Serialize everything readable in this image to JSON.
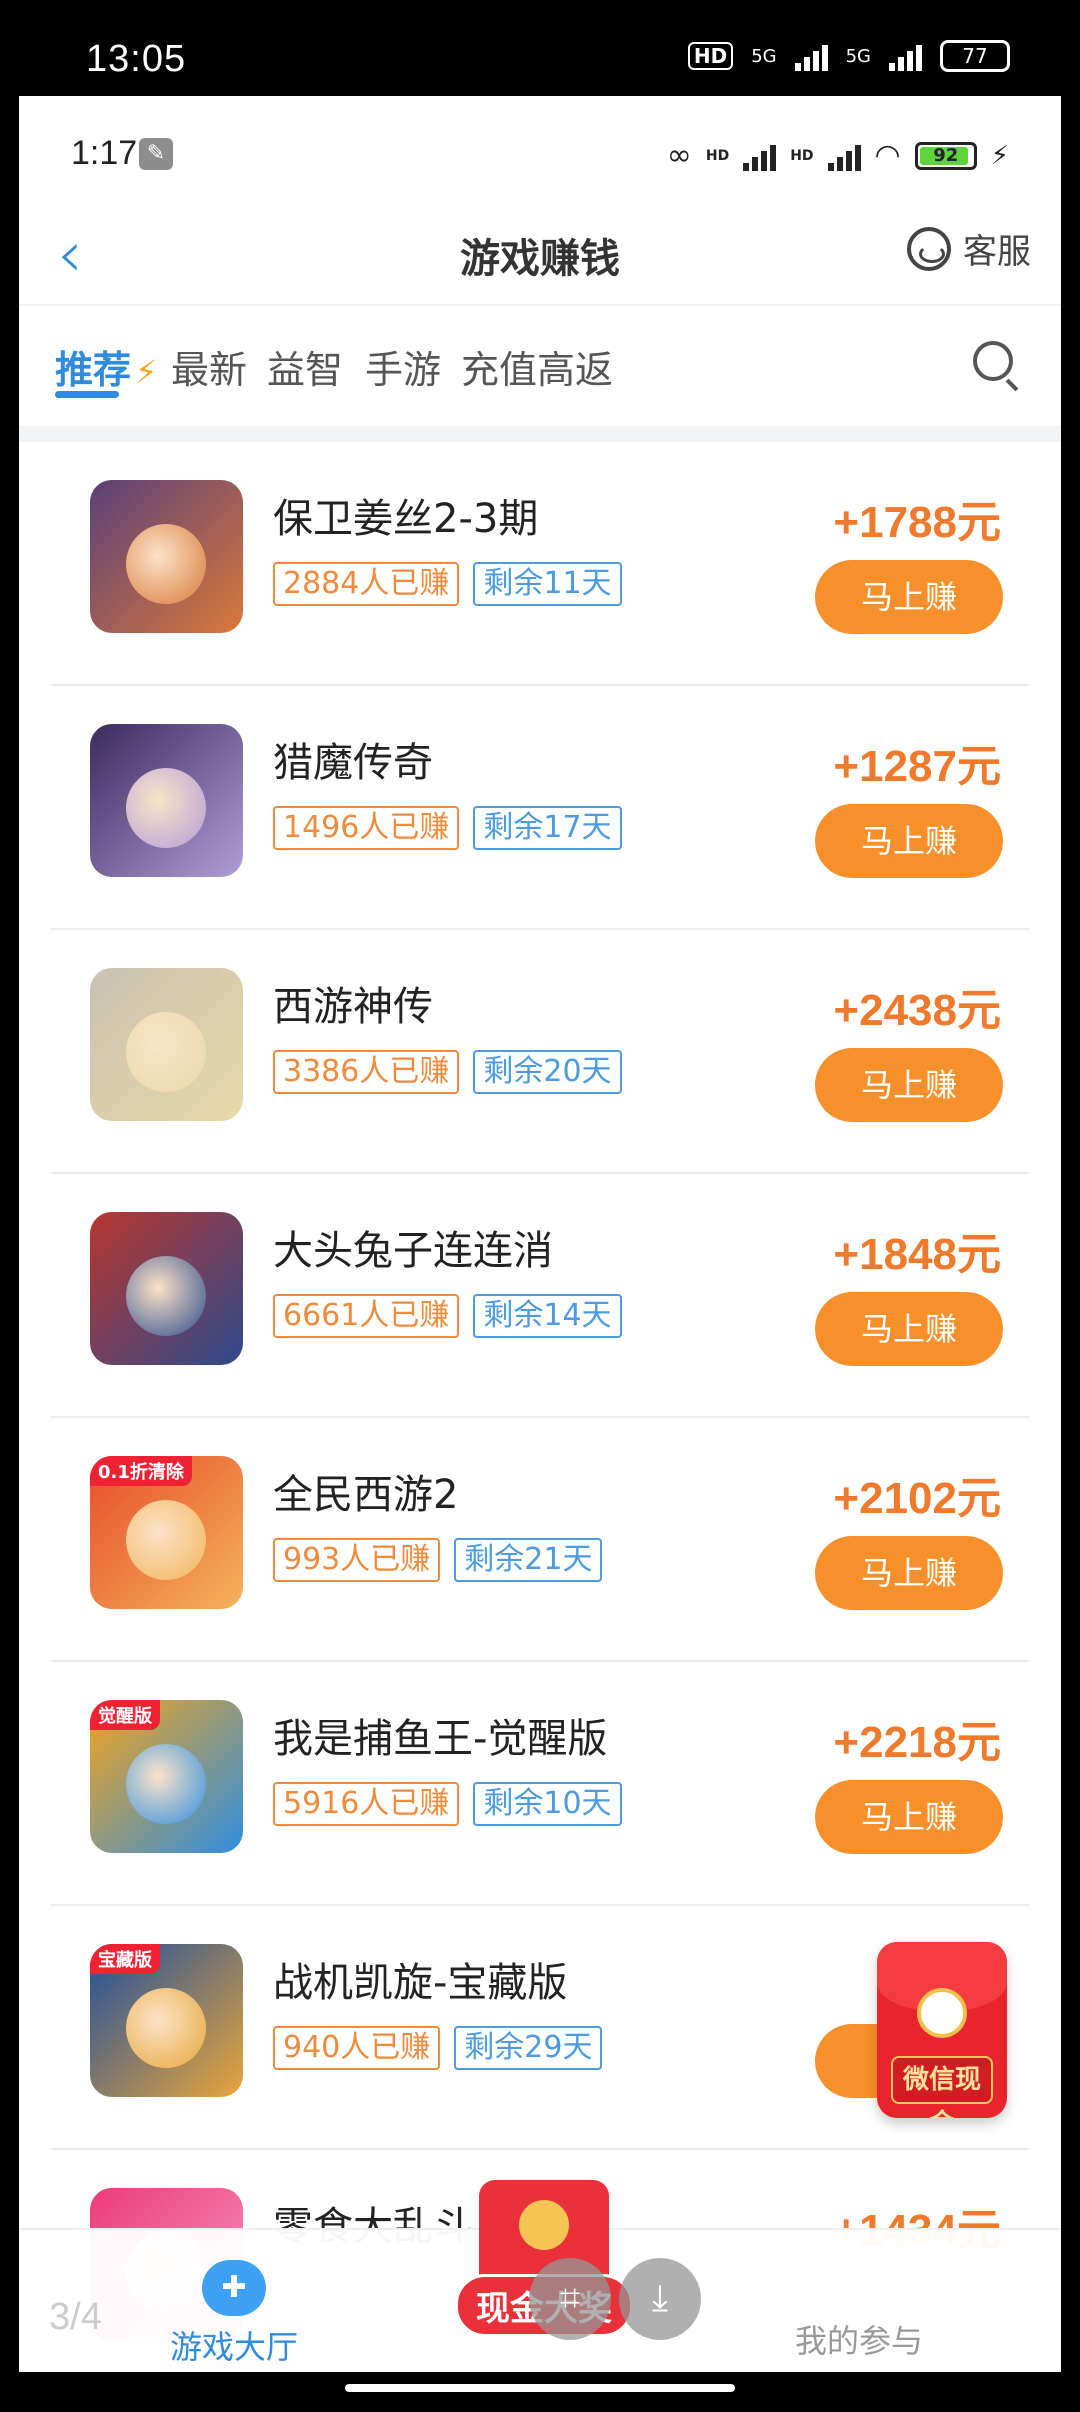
{
  "outer_status": {
    "time": "13:05",
    "hd": "HD",
    "net1": "5G",
    "net2": "5G",
    "battery": "77"
  },
  "inner_status": {
    "time": "1:17",
    "hd1": "HD",
    "hd2": "HD",
    "battery": "92"
  },
  "header": {
    "title": "游戏赚钱",
    "service_label": "客服"
  },
  "tabs": [
    {
      "label": "推荐",
      "active": true
    },
    {
      "label": "最新"
    },
    {
      "label": "益智"
    },
    {
      "label": "手游"
    },
    {
      "label": "充值高返"
    }
  ],
  "games": [
    {
      "name": "保卫姜丝2-3期",
      "earned": "2884人已赚",
      "days_left": "剩余11天",
      "reward": "+1788元",
      "button": "马上赚",
      "colors": [
        "#5b3f7a",
        "#d9793a"
      ]
    },
    {
      "name": "猎魔传奇",
      "earned": "1496人已赚",
      "days_left": "剩余17天",
      "reward": "+1287元",
      "button": "马上赚",
      "colors": [
        "#3b2a5e",
        "#b39dd8"
      ]
    },
    {
      "name": "西游神传",
      "earned": "3386人已赚",
      "days_left": "剩余20天",
      "reward": "+2438元",
      "button": "马上赚",
      "colors": [
        "#c9c2b0",
        "#e8d9a8"
      ]
    },
    {
      "name": "大头兔子连连消",
      "earned": "6661人已赚",
      "days_left": "剩余14天",
      "reward": "+1848元",
      "button": "马上赚",
      "colors": [
        "#b8362f",
        "#2d4a8c"
      ]
    },
    {
      "name": "全民西游2",
      "earned": "993人已赚",
      "days_left": "剩余21天",
      "reward": "+2102元",
      "button": "马上赚",
      "colors": [
        "#e84d2b",
        "#f3b35a"
      ],
      "badge": "0.1折清除"
    },
    {
      "name": "我是捕鱼王-觉醒版",
      "earned": "5916人已赚",
      "days_left": "剩余10天",
      "reward": "+2218元",
      "button": "马上赚",
      "colors": [
        "#f2a41e",
        "#2f8ee0"
      ],
      "badge": "觉醒版"
    },
    {
      "name": "战机凯旋-宝藏版",
      "earned": "940人已赚",
      "days_left": "剩余29天",
      "reward": "+9",
      "button": "马",
      "colors": [
        "#1e4f9c",
        "#e9a63a"
      ],
      "badge": "宝藏版"
    },
    {
      "name": "零食大乱斗",
      "earned": "",
      "days_left": "",
      "reward": "+1434元",
      "button": "",
      "colors": [
        "#ec3b7a",
        "#f59ac0"
      ]
    }
  ],
  "red_packet": {
    "label": "微信现金"
  },
  "bottom_nav": {
    "game_hall": "游戏大厅",
    "cash_prize": "现金大奖",
    "mine": "我的参与",
    "page_count": "3/4"
  },
  "accent": "#2f8bdc",
  "orange": "#f7902b"
}
